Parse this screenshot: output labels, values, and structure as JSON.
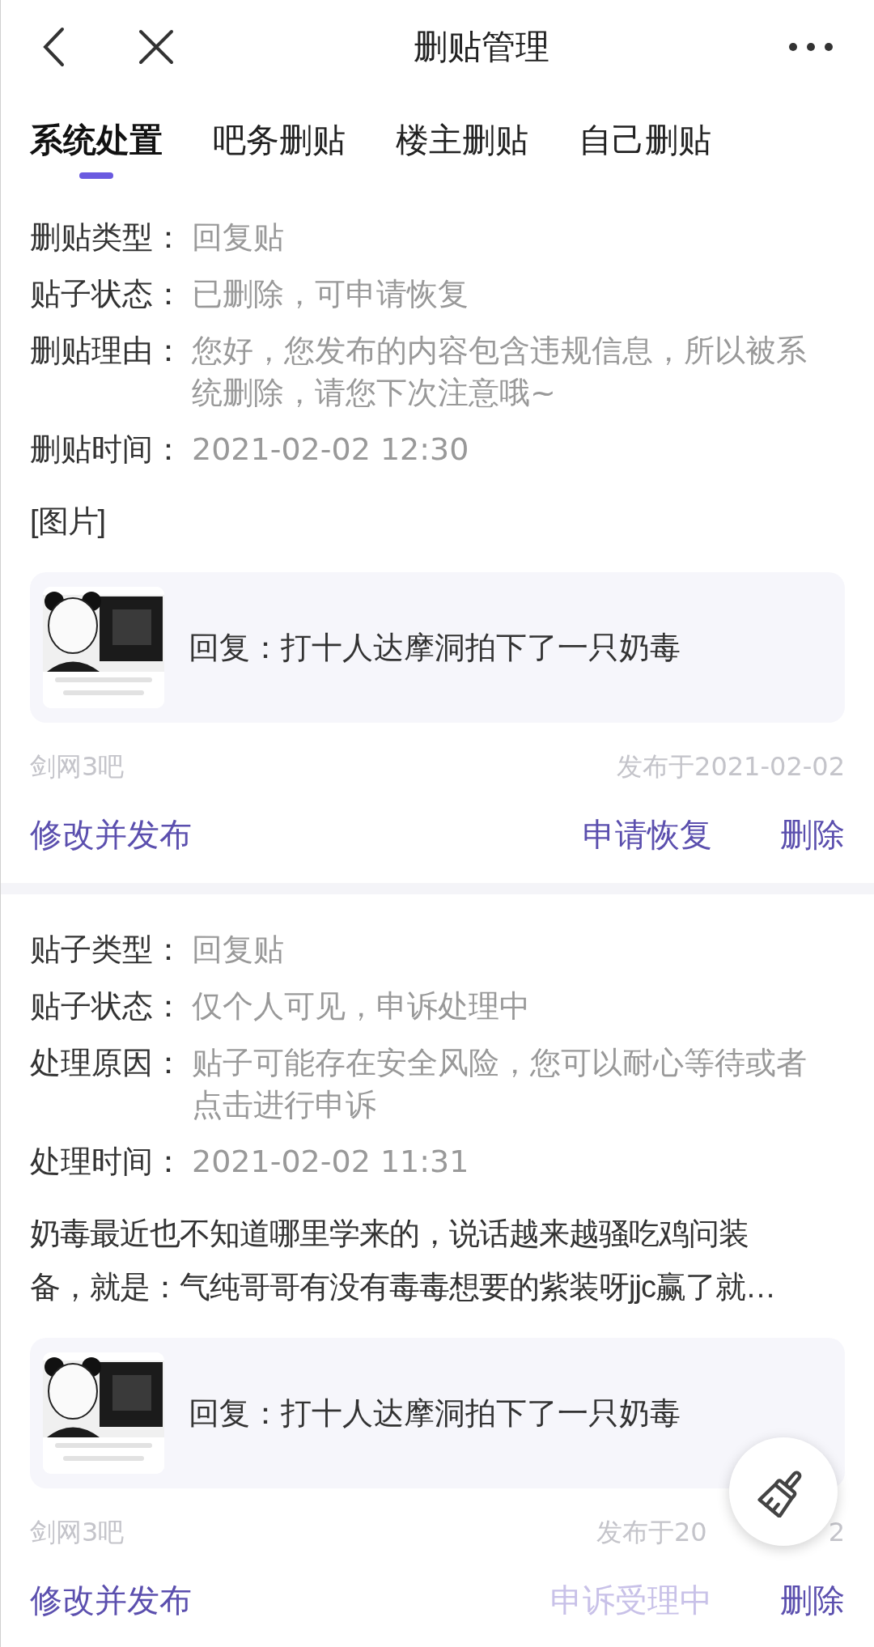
{
  "header": {
    "title": "删贴管理"
  },
  "tabs": [
    {
      "label": "系统处置",
      "selected": true
    },
    {
      "label": "吧务删贴",
      "selected": false
    },
    {
      "label": "楼主删贴",
      "selected": false
    },
    {
      "label": "自己删贴",
      "selected": false
    }
  ],
  "posts": [
    {
      "fields": [
        {
          "label": "删贴类型：",
          "value": "回复贴"
        },
        {
          "label": "贴子状态：",
          "value": "已删除，可申请恢复"
        },
        {
          "label": "删贴理由：",
          "value": "您好，您发布的内容包含违规信息，所以被系统删除，请您下次注意哦~"
        },
        {
          "label": "删贴时间：",
          "value": "2021-02-02 12:30"
        }
      ],
      "content": "[图片]",
      "quote": {
        "kind": "picture",
        "text": "回复：打十人达摩洞拍下了一只奶毒"
      },
      "forum": "剑网3吧",
      "date_parts": [
        "发布于2021-02-02"
      ],
      "actions": [
        {
          "label": "修改并发布",
          "disabled": false
        },
        {
          "label": "申请恢复",
          "disabled": false
        },
        {
          "label": "删除",
          "disabled": false
        }
      ]
    },
    {
      "fields": [
        {
          "label": "贴子类型：",
          "value": "回复贴"
        },
        {
          "label": "贴子状态：",
          "value": "仅个人可见，申诉处理中"
        },
        {
          "label": "处理原因：",
          "value": "贴子可能存在安全风险，您可以耐心等待或者点击进行申诉"
        },
        {
          "label": "处理时间：",
          "value": "2021-02-02 11:31"
        }
      ],
      "content": "奶毒最近也不知道哪里学来的，说话越来越骚吃鸡问装备，就是：气纯哥哥有没有毒毒想要的紫装呀jjc赢了就…",
      "quote": {
        "kind": "picture",
        "text": "回复：打十人达摩洞拍下了一只奶毒"
      },
      "forum": "剑网3吧",
      "date_parts": [
        "发布于20",
        "2"
      ],
      "actions": [
        {
          "label": "修改并发布",
          "disabled": false
        },
        {
          "label": "申诉受理中",
          "disabled": true
        },
        {
          "label": "删除",
          "disabled": false
        }
      ]
    }
  ]
}
